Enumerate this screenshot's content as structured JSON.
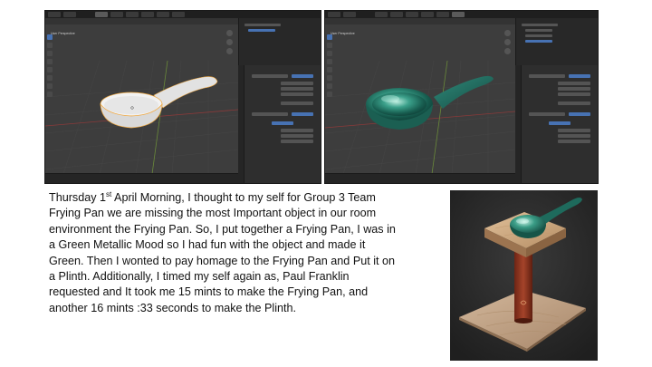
{
  "caption": {
    "line1_before": "Thursday 1",
    "line1_sup": "st",
    "line1_after": " April Morning, I thought to my self for Group 3 Team",
    "line2": "Frying Pan we are missing the most Important object in our room",
    "line3": "environment the Frying Pan. So, I put together a Frying Pan, I was in",
    "line4": "a Green Metallic Mood so I had fun with the object and made it",
    "line5": "Green. Then I wonted to pay homage to the Frying Pan and Put it on",
    "line6": "a Plinth. Additionally, I timed my self again as, Paul Franklin",
    "line7": "requested and It took me 15 mints to make the Frying Pan, and",
    "line8": "another 16 mints :33 seconds to make the Plinth."
  },
  "screenshots": {
    "left": {
      "viewport_label": "User Perspective",
      "pan_color": "#e9e9e9"
    },
    "right": {
      "viewport_label": "User Perspective",
      "pan_color": "#2f8a7a"
    }
  },
  "render": {
    "pan_color": "#2f8a7a",
    "plinth_top_color": "#c9a27a",
    "column_color": "#9c3b22"
  },
  "colors": {
    "blender_bg": "#3d3d3d",
    "accent_blue": "#4772b3",
    "selection_orange": "#e8a040"
  }
}
